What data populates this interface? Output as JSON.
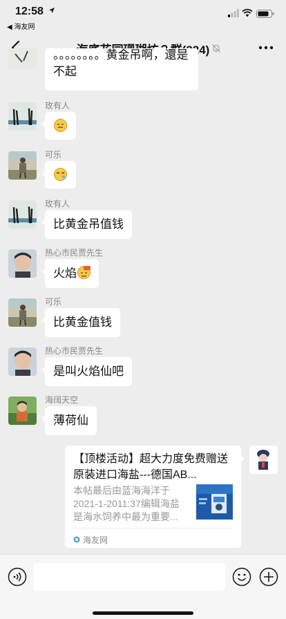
{
  "status_bar": {
    "time": "12:58",
    "back_app": "◀ 海友网"
  },
  "header": {
    "title": "海底花园珊瑚坊２群(324)"
  },
  "messages": [
    {
      "kind": "text",
      "sender": "",
      "text_line1": "。。。。。。。。黄金吊啊，還是",
      "text_line2": "不起"
    },
    {
      "kind": "emoji",
      "sender": "玫有人",
      "emoji": "thinking-face-emoji"
    },
    {
      "kind": "emoji",
      "sender": "可乐",
      "emoji": "sleepy-face-emoji"
    },
    {
      "kind": "text",
      "sender": "玫有人",
      "text": "比黄金吊值钱"
    },
    {
      "kind": "text",
      "sender": "热心市民贾先生",
      "text": "火焰",
      "emoji": "666-emoji"
    },
    {
      "kind": "text",
      "sender": "可乐",
      "text": "比黄金值钱"
    },
    {
      "kind": "text",
      "sender": "热心市民贾先生",
      "text": "是叫火焰仙吧"
    },
    {
      "kind": "text",
      "sender": "海阔天空",
      "text": "薄荷仙"
    }
  ],
  "link_card": {
    "title": "【顶楼活动】超大力度免费赠送原装进口海盐---德国AB...",
    "description": "本帖最后由蓝海海洋于2021-1-2011:37编辑海盐是海水饲养中最为重要...",
    "source": "海友网"
  },
  "input_bar": {
    "placeholder": ""
  },
  "colors": {
    "background": "#ededed",
    "bubble": "#ffffff",
    "sender_name": "#888888",
    "card_description": "#999999"
  }
}
